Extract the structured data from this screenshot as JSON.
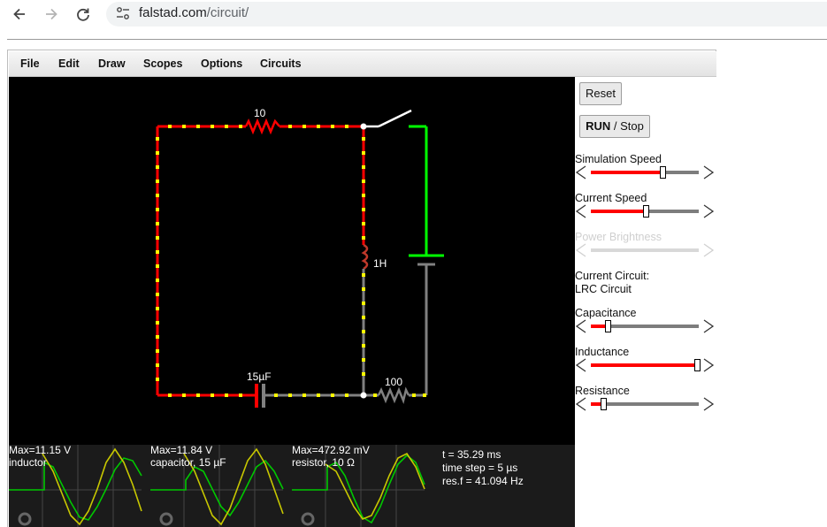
{
  "browser": {
    "url_host": "falstad.com",
    "url_path": "/circuit/",
    "icons": [
      "back-arrow-icon",
      "forward-arrow-icon",
      "reload-icon",
      "site-settings-icon"
    ]
  },
  "menu": {
    "file": "File",
    "edit": "Edit",
    "draw": "Draw",
    "scopes": "Scopes",
    "options": "Options",
    "circuits": "Circuits"
  },
  "circuit": {
    "resistor_top_label": "10",
    "inductor_label": "1H",
    "capacitor_label": "15µF",
    "resistor_bottom_label": "100",
    "colors": {
      "wire_red": "#ff0000",
      "wire_gray": "#7f7f7f",
      "wire_green": "#00ff00",
      "current_dots": "#ffff00"
    }
  },
  "scopes": [
    {
      "max": "Max=11.15 V",
      "name": "inductor"
    },
    {
      "max": "Max=11.84 V",
      "name": "capacitor, 15 µF"
    },
    {
      "max": "Max=472.92 mV",
      "name": "resistor, 10 Ω"
    }
  ],
  "sim_info": {
    "time": "t = 35.29 ms",
    "timestep": "time step = 5 µs",
    "resf": "res.f = 41.094 Hz"
  },
  "panel": {
    "reset_label": "Reset",
    "run_label": "RUN",
    "stop_label": " / Stop",
    "current_circuit_label": "Current Circuit:",
    "current_circuit_name": "LRC Circuit",
    "sliders": [
      {
        "label": "Simulation Speed",
        "value": 0.67,
        "enabled": true
      },
      {
        "label": "Current Speed",
        "value": 0.5,
        "enabled": true
      },
      {
        "label": "Power Brightness",
        "value": 0.5,
        "enabled": false
      },
      {
        "label": "Capacitance",
        "value": 0.14,
        "enabled": true
      },
      {
        "label": "Inductance",
        "value": 1.0,
        "enabled": true
      },
      {
        "label": "Resistance",
        "value": 0.09,
        "enabled": true
      }
    ]
  }
}
